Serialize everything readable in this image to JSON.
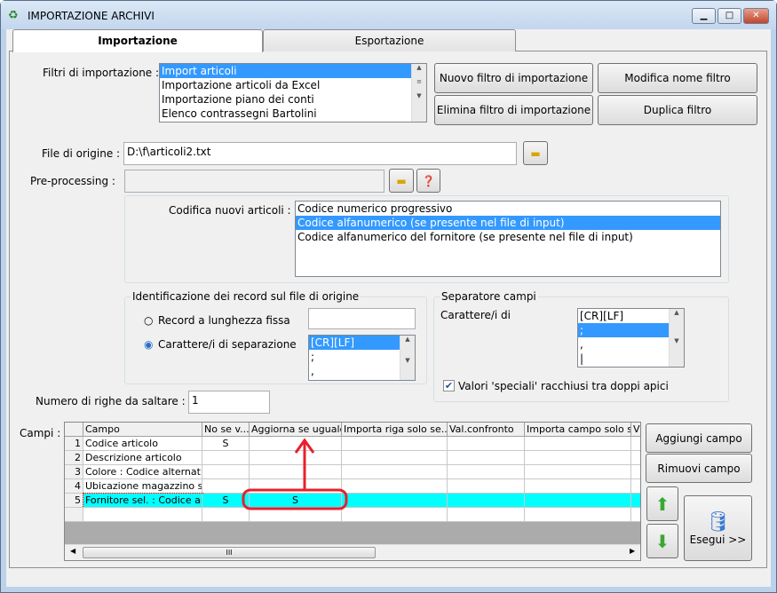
{
  "window": {
    "title": "IMPORTAZIONE ARCHIVI",
    "minimize": "▁",
    "maximize": "□",
    "close": "✕"
  },
  "tabs": [
    {
      "label": "Importazione",
      "active": true
    },
    {
      "label": "Esportazione",
      "active": false
    }
  ],
  "filters": {
    "label": "Filtri di importazione :",
    "items": [
      "Import articoli",
      "Importazione articoli da Excel",
      "Importazione piano dei conti",
      "Elenco contrassegni Bartolini"
    ],
    "selected": 0
  },
  "buttons": {
    "new_filter": "Nuovo filtro di importazione",
    "rename_filter": "Modifica nome filtro",
    "delete_filter": "Elimina filtro di importazione",
    "duplicate_filter": "Duplica filtro",
    "add_field": "Aggiungi campo",
    "remove_field": "Rimuovi campo",
    "run": "Esegui >>"
  },
  "source_file": {
    "label": "File di origine :",
    "value": "D:\\f\\articoli2.txt"
  },
  "preprocessing": {
    "label": "Pre-processing :",
    "value": ""
  },
  "coding": {
    "label": "Codifica nuovi articoli :",
    "items": [
      "Codice numerico progressivo",
      "Codice alfanumerico (se presente nel file di input)",
      "Codice alfanumerico del fornitore (se presente nel file di input)"
    ],
    "selected": 1
  },
  "record_id": {
    "legend": "Identificazione dei record sul file di origine",
    "fixed_length": "Record a lunghezza fissa",
    "separator_chars": "Carattere/i di separazione",
    "selected_option": "separator_chars",
    "separator_items": [
      "[CR][LF]",
      ";",
      ","
    ]
  },
  "field_separator": {
    "legend": "Separatore campi",
    "label": "Carattere/i di",
    "items": [
      "[CR][LF]",
      ";",
      ",",
      "|"
    ],
    "selected": 1,
    "quotes_checkbox": "Valori 'speciali' racchiusi tra doppi apici",
    "quotes_checked": true
  },
  "skip_rows": {
    "label": "Numero di righe da saltare :",
    "value": "1"
  },
  "fields": {
    "label": "Campi :",
    "columns": [
      "Campo",
      "No se v...",
      "Aggiorna se uguale",
      "Importa riga solo se...",
      "Val.confronto",
      "Importa campo solo s...",
      "V"
    ],
    "rows": [
      {
        "n": "1",
        "campo": "Codice articolo",
        "no": "S",
        "agg": ""
      },
      {
        "n": "2",
        "campo": "Descrizione articolo",
        "no": "",
        "agg": ""
      },
      {
        "n": "3",
        "campo": "Colore : Codice alternativo",
        "no": "",
        "agg": ""
      },
      {
        "n": "4",
        "campo": "Ubicazione magazzino s...",
        "no": "",
        "agg": ""
      },
      {
        "n": "5",
        "campo": "Fornitore sel. : Codice art...",
        "no": "S",
        "agg": "S"
      }
    ],
    "selected_row": 4,
    "hscroll_grip": "III"
  },
  "colors": {
    "selection": "#3399ff",
    "row_highlight": "#00ffff",
    "annotation": "#e8202a"
  }
}
